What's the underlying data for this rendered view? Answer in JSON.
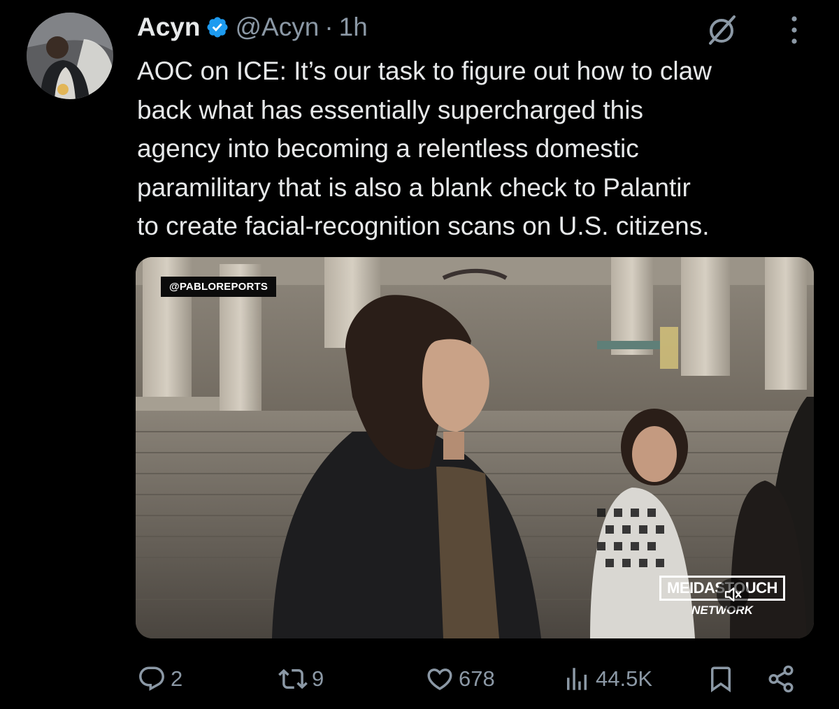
{
  "tweet": {
    "author": {
      "name": "Acyn",
      "handle": "@Acyn",
      "separator": "·",
      "time": "1h",
      "verified": true,
      "avatar_icon": "avatar-photo"
    },
    "text_lines": [
      "AOC on ICE: It’s our task to figure out how to claw",
      "back what has essentially supercharged this",
      "agency into becoming a relentless domestic",
      "paramilitary that is also a blank check to Palantir",
      "to create facial-recognition scans on U.S. citizens."
    ],
    "media": {
      "type": "video",
      "watermark": "@PABLOREPORTS",
      "overlay_brand": "MEIDASTOUCH",
      "overlay_sub": "NETWORK",
      "muted": true
    },
    "actions": {
      "replies": "2",
      "reposts": "9",
      "likes": "678",
      "views": "44.5K"
    }
  },
  "colors": {
    "background": "#000000",
    "text": "#e7e9ea",
    "secondary": "#8b98a5",
    "verified": "#1d9bf0"
  }
}
